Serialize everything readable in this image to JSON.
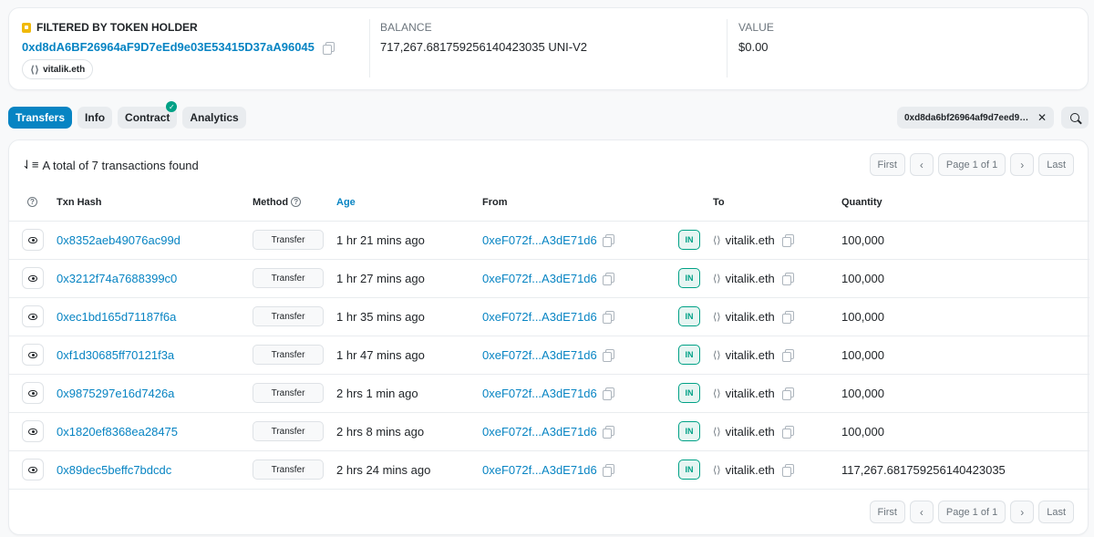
{
  "header": {
    "filter_label": "FILTERED BY TOKEN HOLDER",
    "holder_address": "0xd8dA6BF26964aF9D7eEd9e03E53415D37aA96045",
    "holder_ens": "vitalik.eth",
    "balance_label": "BALANCE",
    "balance_value": "717,267.681759256140423035 UNI-V2",
    "value_label": "VALUE",
    "value_value": "$0.00"
  },
  "tabs": [
    {
      "label": "Transfers",
      "active": true
    },
    {
      "label": "Info",
      "active": false
    },
    {
      "label": "Contract",
      "active": false,
      "verified": true
    },
    {
      "label": "Analytics",
      "active": false
    }
  ],
  "filter_chip": {
    "text": "0xd8da6bf26964af9d7eed9e03e53415d37aa96045"
  },
  "summary": {
    "total_text": "A total of 7 transactions found"
  },
  "pagination": {
    "first": "First",
    "page_text": "Page 1 of 1",
    "last": "Last",
    "prev": "‹",
    "next": "›"
  },
  "table": {
    "headers": {
      "txn_hash": "Txn Hash",
      "method": "Method",
      "age": "Age",
      "from": "From",
      "to": "To",
      "quantity": "Quantity"
    },
    "rows": [
      {
        "hash": "0x8352aeb49076ac99d",
        "method": "Transfer",
        "age": "1 hr 21 mins ago",
        "from": "0xeF072f...A3dE71d6",
        "direction": "IN",
        "to": "vitalik.eth",
        "quantity": "100,000"
      },
      {
        "hash": "0x3212f74a7688399c0",
        "method": "Transfer",
        "age": "1 hr 27 mins ago",
        "from": "0xeF072f...A3dE71d6",
        "direction": "IN",
        "to": "vitalik.eth",
        "quantity": "100,000"
      },
      {
        "hash": "0xec1bd165d71187f6a",
        "method": "Transfer",
        "age": "1 hr 35 mins ago",
        "from": "0xeF072f...A3dE71d6",
        "direction": "IN",
        "to": "vitalik.eth",
        "quantity": "100,000"
      },
      {
        "hash": "0xf1d30685ff70121f3a",
        "method": "Transfer",
        "age": "1 hr 47 mins ago",
        "from": "0xeF072f...A3dE71d6",
        "direction": "IN",
        "to": "vitalik.eth",
        "quantity": "100,000"
      },
      {
        "hash": "0x9875297e16d7426a",
        "method": "Transfer",
        "age": "2 hrs 1 min ago",
        "from": "0xeF072f...A3dE71d6",
        "direction": "IN",
        "to": "vitalik.eth",
        "quantity": "100,000"
      },
      {
        "hash": "0x1820ef8368ea28475",
        "method": "Transfer",
        "age": "2 hrs 8 mins ago",
        "from": "0xeF072f...A3dE71d6",
        "direction": "IN",
        "to": "vitalik.eth",
        "quantity": "100,000"
      },
      {
        "hash": "0x89dec5beffc7bdcdc",
        "method": "Transfer",
        "age": "2 hrs 24 mins ago",
        "from": "0xeF072f...A3dE71d6",
        "direction": "IN",
        "to": "vitalik.eth",
        "quantity": "117,267.681759256140423035"
      }
    ]
  },
  "icons": {
    "view": "eye-icon",
    "copy": "copy-icon",
    "ens": "ens-icon",
    "sort": "sort-icon",
    "search": "search-icon",
    "close": "close-icon",
    "help": "help-icon",
    "verified": "check-icon",
    "filter": "filter-icon"
  },
  "colors": {
    "accent": "#0784c3",
    "success": "#00a186",
    "warning": "#f0b90b"
  }
}
